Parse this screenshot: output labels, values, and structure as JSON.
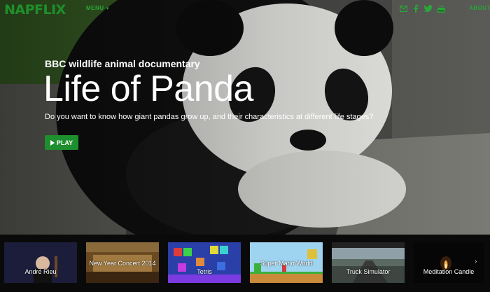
{
  "app": {
    "logo": "NAPFLIX"
  },
  "nav": {
    "menu_label": "MENU",
    "about_label": "ABOUT",
    "social_icons": [
      "mail-icon",
      "facebook-icon",
      "twitter-icon",
      "youtube-icon"
    ]
  },
  "hero": {
    "subtitle": "BBC wildlife animal documentary",
    "title": "Life of Panda",
    "description": "Do you want to know how giant pandas grow up, and their characteristics at different life stages?",
    "play_label": "PLAY"
  },
  "carousel": {
    "prev_icon": "chevron-left-icon",
    "next_icon": "chevron-right-icon",
    "items": [
      {
        "label": "André Rieu"
      },
      {
        "label": "New Year Concert 2014"
      },
      {
        "label": "Tetris"
      },
      {
        "label": "Super Mario World"
      },
      {
        "label": "Truck Simulator"
      },
      {
        "label": "Meditation Candle"
      }
    ]
  },
  "colors": {
    "accent": "#1f8f2a",
    "play_button": "#1e8f2e",
    "background": "#0a0a0a"
  }
}
